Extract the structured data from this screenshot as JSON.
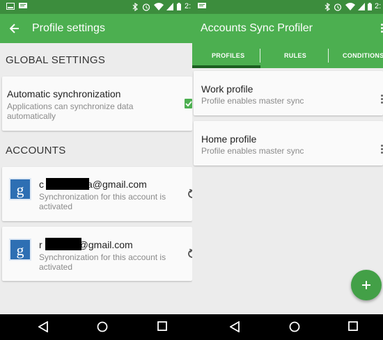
{
  "left_screen": {
    "status_bar": {
      "time": "2:"
    },
    "app_bar": {
      "title": "Profile settings"
    },
    "global_settings": {
      "header": "GLOBAL SETTINGS",
      "auto_sync": {
        "title": "Automatic synchronization",
        "subtitle": "Applications can synchronize data automatically",
        "checked": true
      }
    },
    "accounts": {
      "header": "ACCOUNTS",
      "items": [
        {
          "email_prefix": "c",
          "email_suffix": "a@gmail.com",
          "status": "Synchronization for this account is activated"
        },
        {
          "email_prefix": "r",
          "email_suffix": "@gmail.com",
          "status": "Synchronization for this account is activated"
        }
      ]
    }
  },
  "right_screen": {
    "status_bar": {
      "time": "2:"
    },
    "app_bar": {
      "title": "Accounts Sync Profiler"
    },
    "tabs": [
      {
        "label": "PROFILES",
        "active": true
      },
      {
        "label": "RULES",
        "active": false
      },
      {
        "label": "CONDITIONS",
        "active": false
      }
    ],
    "profiles": [
      {
        "name": "Work profile",
        "description": "Profile enables master sync"
      },
      {
        "name": "Home profile",
        "description": "Profile enables master sync"
      }
    ]
  },
  "colors": {
    "primary": "#4caf50",
    "status_bar": "#3c8d3d",
    "accent_dark": "#1b5e20",
    "fab": "#43a047",
    "google_blue": "#2e6fb3"
  },
  "icons": {
    "back": "arrow-left-icon",
    "overflow": "overflow-menu-icon",
    "sync": "sync-icon",
    "google": "google-g-icon",
    "add": "plus-icon",
    "nav_back": "triangle-back-icon",
    "nav_home": "circle-home-icon",
    "nav_recents": "square-recents-icon"
  }
}
